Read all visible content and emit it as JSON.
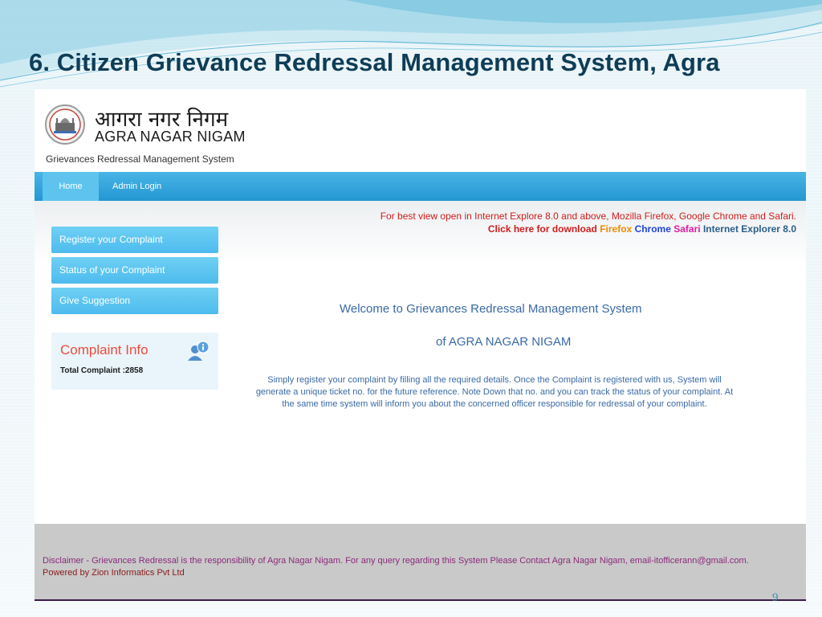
{
  "slide": {
    "title": "6. Citizen Grievance Redressal Management System, Agra",
    "page_number": "9"
  },
  "site": {
    "logo_hindi": "आगरा नगर निगम",
    "logo_english": "AGRA NAGAR NIGAM",
    "subtitle": "Grievances Redressal Management System",
    "nav": {
      "home": "Home",
      "admin_login": "Admin Login"
    },
    "best_view": "For best view open in Internet Explore 8.0 and above, Mozilla Firefox, Google Chrome and Safari.",
    "download": {
      "label": "Click here for download",
      "firefox": "Firefox",
      "chrome": "Chrome",
      "safari": "Safari",
      "ie": "Internet Explorer 8.0"
    },
    "sidebar": {
      "register": "Register your Complaint",
      "status": "Status of your Complaint",
      "suggestion": "Give Suggestion"
    },
    "complaint_info": {
      "title": "Complaint Info",
      "total": "Total Complaint :2858"
    },
    "welcome": {
      "line1": "Welcome to Grievances Redressal Management System",
      "line2": "of  AGRA NAGAR NIGAM",
      "description": "Simply register your complaint by filling all the required details. Once the Complaint is registered with us,  System will generate a unique ticket no. for the future reference. Note Down that no. and you can track the status of your complaint. At the same time system will inform you about the concerned officer responsible for redressal of your complaint."
    },
    "footer": {
      "disclaimer": "Disclaimer - Grievances Redressal is the responsibility of Agra Nagar Nigam. For any query regarding this System Please Contact Agra Nagar Nigam, email-itofficerann@gmail.com.",
      "powered_by": "Powered by Zion Informatics Pvt Ltd"
    }
  }
}
